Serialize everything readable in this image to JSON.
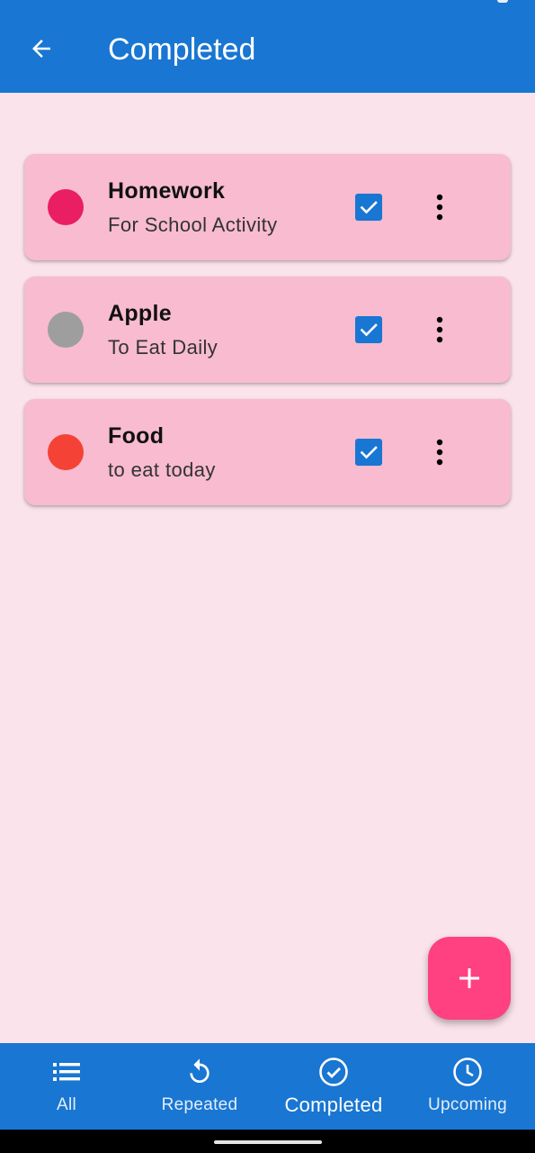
{
  "appbar": {
    "title": "Completed",
    "background": "#1976d2"
  },
  "tasks": [
    {
      "title": "Homework",
      "subtitle": "For School Activity",
      "color": "#e91e63",
      "checked": true
    },
    {
      "title": "Apple",
      "subtitle": "To Eat Daily",
      "color": "#9e9e9e",
      "checked": true
    },
    {
      "title": "Food",
      "subtitle": "to eat today",
      "color": "#f44336",
      "checked": true
    }
  ],
  "fab": {
    "icon": "plus-icon",
    "color": "#ff4081"
  },
  "bottom_nav": {
    "items": [
      {
        "label": "All",
        "icon": "list-icon"
      },
      {
        "label": "Repeated",
        "icon": "repeat-icon"
      },
      {
        "label": "Completed",
        "icon": "check-circle-icon",
        "active": true
      },
      {
        "label": "Upcoming",
        "icon": "clock-icon"
      }
    ]
  },
  "colors": {
    "page_background": "#fae3ea",
    "card_background": "#f8bbd0",
    "checkbox": "#1976d2"
  }
}
